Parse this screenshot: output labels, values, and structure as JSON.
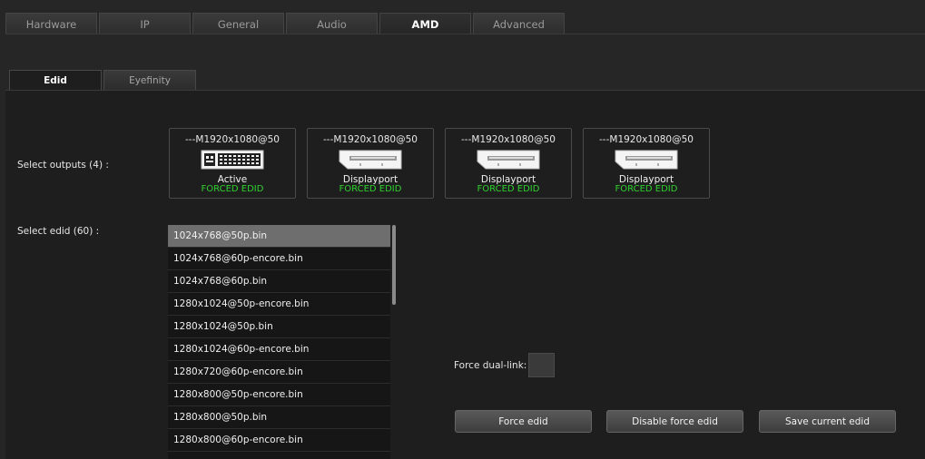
{
  "top_tabs": [
    {
      "label": "Hardware"
    },
    {
      "label": "IP"
    },
    {
      "label": "General"
    },
    {
      "label": "Audio"
    },
    {
      "label": "AMD"
    },
    {
      "label": "Advanced"
    }
  ],
  "sub_tabs": [
    {
      "label": "Edid"
    },
    {
      "label": "Eyefinity"
    }
  ],
  "outputs_label": "Select outputs (4) :",
  "edid_label": "Select edid (60) :",
  "outputs": [
    {
      "resolution": "---M1920x1080@50",
      "name": "Active",
      "status": "FORCED EDID",
      "port": "dvi-port-icon"
    },
    {
      "resolution": "---M1920x1080@50",
      "name": "Displayport",
      "status": "FORCED EDID",
      "port": "displayport-icon"
    },
    {
      "resolution": "---M1920x1080@50",
      "name": "Displayport",
      "status": "FORCED EDID",
      "port": "displayport-icon"
    },
    {
      "resolution": "---M1920x1080@50",
      "name": "Displayport",
      "status": "FORCED EDID",
      "port": "displayport-icon"
    }
  ],
  "edid_list": [
    "1024x768@50p.bin",
    "1024x768@60p-encore.bin",
    "1024x768@60p.bin",
    "1280x1024@50p-encore.bin",
    "1280x1024@50p.bin",
    "1280x1024@60p-encore.bin",
    "1280x720@60p-encore.bin",
    "1280x800@50p-encore.bin",
    "1280x800@50p.bin",
    "1280x800@60p-encore.bin"
  ],
  "force_dual_link_label": "Force dual-link:",
  "buttons": {
    "force": "Force edid",
    "disable": "Disable force edid",
    "save": "Save current edid"
  },
  "colors": {
    "status_green": "#2fd12f",
    "selected_row": "#6e6e6e"
  }
}
